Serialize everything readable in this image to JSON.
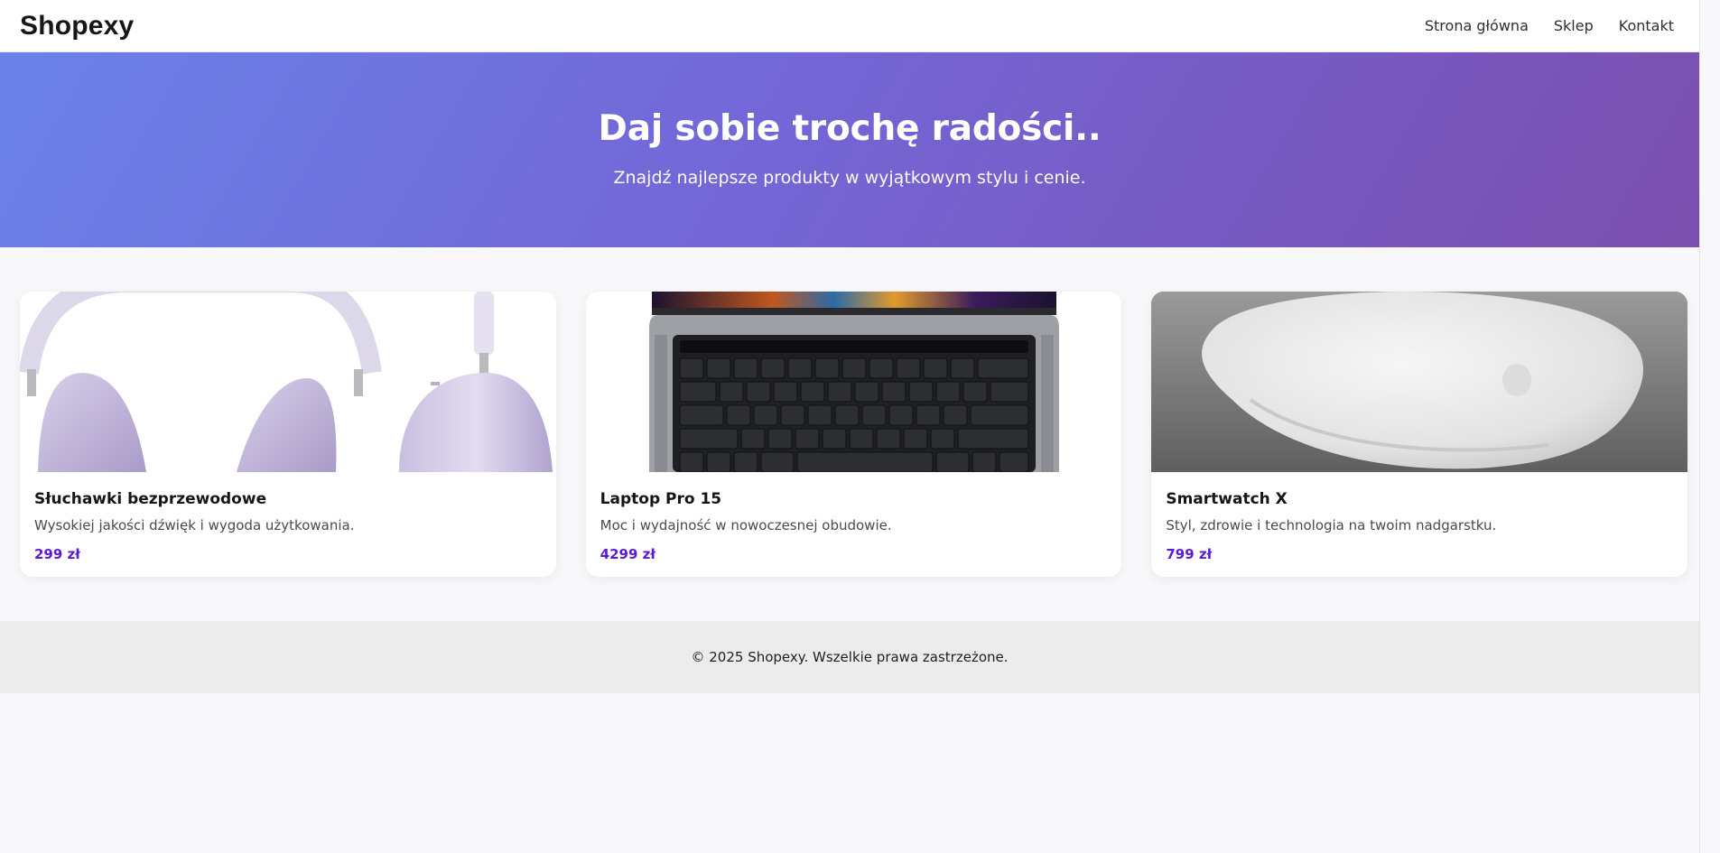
{
  "header": {
    "logo": "Shopexy",
    "nav": [
      {
        "label": "Strona główna"
      },
      {
        "label": "Sklep"
      },
      {
        "label": "Kontakt"
      }
    ]
  },
  "hero": {
    "title": "Daj sobie trochę radości..",
    "subtitle": "Znajdź najlepsze produkty w wyjątkowym stylu i cenie."
  },
  "products": [
    {
      "title": "Słuchawki bezprzewodowe",
      "description": "Wysokiej jakości dźwięk i wygoda użytkowania.",
      "price": "299 zł",
      "image": "headphones-image"
    },
    {
      "title": "Laptop Pro 15",
      "description": "Moc i wydajność w nowoczesnej obudowie.",
      "price": "4299 zł",
      "image": "laptop-image"
    },
    {
      "title": "Smartwatch X",
      "description": "Styl, zdrowie i technologia na twoim nadgarstku.",
      "price": "799 zł",
      "image": "mouse-image"
    }
  ],
  "footer": {
    "text": "© 2025 Shopexy. Wszelkie prawa zastrzeżone."
  },
  "colors": {
    "hero_gradient_start": "#6a82e8",
    "hero_gradient_end": "#7a4fae",
    "price": "#5a1ad6",
    "footer_bg": "#ececec",
    "page_bg": "#f8f8fa"
  }
}
